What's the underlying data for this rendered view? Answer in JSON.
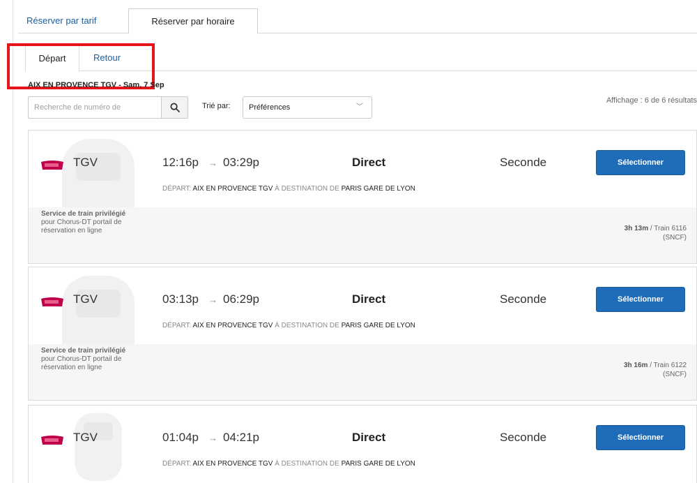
{
  "top_tabs": [
    "Réserver par tarif",
    "Réserver par horaire"
  ],
  "sub_tabs": [
    "Départ",
    "Retour"
  ],
  "route_line": "AIX EN PROVENCE TGV - Sam, 7 Sep",
  "search": {
    "placeholder": "Recherche de numéro de"
  },
  "sort": {
    "label": "Trié par:",
    "value": "Préférences"
  },
  "result_count": "Affichage : 6 de 6 résultats",
  "colors": {
    "accent": "#1f6db9",
    "highlight": "#e8141c",
    "link": "#1d5fa0"
  },
  "results": [
    {
      "carrier": "TGV",
      "depart_time": "12:16p",
      "arrive_time": "03:29p",
      "stops": "Direct",
      "class": "Seconde",
      "button": "Sélectionner",
      "route_prefix": "DÉPART:",
      "origin": "AIX EN PROVENCE TGV",
      "route_mid": "À DESTINATION DE",
      "destination": "PARIS GARE DE LYON",
      "service_bold": "Service de train privilégié",
      "service_rest": "pour Chorus-DT portail de réservation en ligne",
      "duration": "3h 13m",
      "train": "/ Train 6116",
      "operator": "(SNCF)"
    },
    {
      "carrier": "TGV",
      "depart_time": "03:13p",
      "arrive_time": "06:29p",
      "stops": "Direct",
      "class": "Seconde",
      "button": "Sélectionner",
      "route_prefix": "DÉPART:",
      "origin": "AIX EN PROVENCE TGV",
      "route_mid": "À DESTINATION DE",
      "destination": "PARIS GARE DE LYON",
      "service_bold": "Service de train privilégié",
      "service_rest": "pour Chorus-DT portail de réservation en ligne",
      "duration": "3h 16m",
      "train": "/ Train 6122",
      "operator": "(SNCF)"
    },
    {
      "carrier": "TGV",
      "depart_time": "01:04p",
      "arrive_time": "04:21p",
      "stops": "Direct",
      "class": "Seconde",
      "button": "Sélectionner",
      "route_prefix": "DÉPART:",
      "origin": "AIX EN PROVENCE TGV",
      "route_mid": "À DESTINATION DE",
      "destination": "PARIS GARE DE LYON"
    }
  ]
}
